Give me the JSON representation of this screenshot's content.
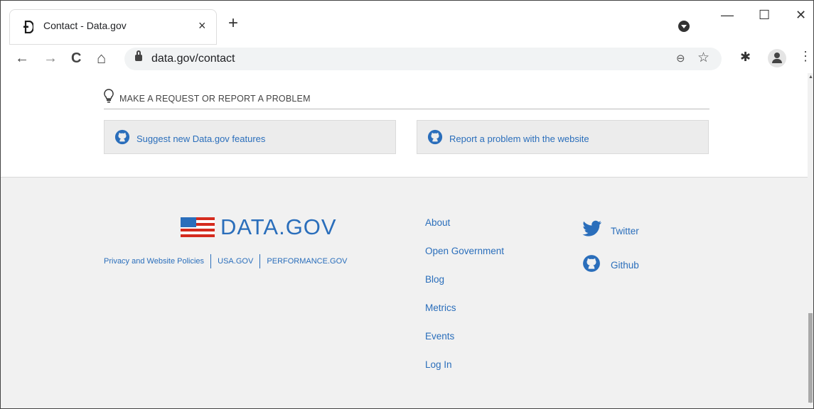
{
  "browser": {
    "tab_title": "Contact - Data.gov",
    "tab_close": "×",
    "new_tab": "+",
    "window_controls": {
      "minimize": "—",
      "maximize": "☐",
      "close": "✕"
    },
    "nav": {
      "back": "←",
      "forward": "→",
      "reload": "C",
      "home": "⌂"
    },
    "url": "data.gov/contact",
    "icons": [
      "lock-icon",
      "zoom-icon",
      "star-icon",
      "extensions-icon",
      "profile-icon",
      "menu-icon"
    ]
  },
  "request_section": {
    "title": "MAKE A REQUEST OR REPORT A PROBLEM",
    "cards": [
      {
        "label": "Suggest new Data.gov features",
        "icon": "github-icon"
      },
      {
        "label": "Report a problem with the website",
        "icon": "github-icon"
      }
    ]
  },
  "footer": {
    "logo_text": "DATA.GOV",
    "policy_links": [
      "Privacy and Website Policies",
      "USA.GOV",
      "PERFORMANCE.GOV"
    ],
    "nav_links": [
      "About",
      "Open Government",
      "Blog",
      "Metrics",
      "Events",
      "Log In"
    ],
    "social": [
      {
        "label": "Twitter",
        "icon": "twitter-icon"
      },
      {
        "label": "Github",
        "icon": "github-icon"
      }
    ]
  },
  "colors": {
    "link": "#2a6ebb",
    "footer_bg": "#f1f1f1",
    "card_bg": "#ececec",
    "flag_red": "#d52b1e",
    "flag_blue": "#2a6ebb"
  }
}
